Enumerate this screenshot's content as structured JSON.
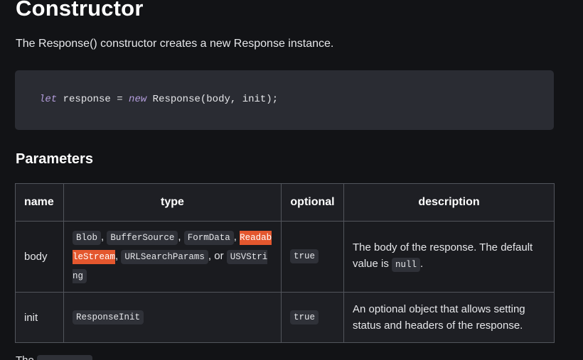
{
  "heading": "Constructor",
  "intro": "The Response() constructor creates a new Response instance.",
  "code": {
    "kw_let": "let",
    "mid": " response = ",
    "kw_new": "new",
    "rest": " Response(body, init);"
  },
  "params_heading": "Parameters",
  "table": {
    "headers": {
      "name": "name",
      "type": "type",
      "optional": "optional",
      "description": "description"
    },
    "rows": [
      {
        "name": "body",
        "types": {
          "t1": "Blob",
          "sep1": ", ",
          "t2": "BufferSource",
          "sep2": ", ",
          "t3": "FormData",
          "sep3": ", ",
          "t4": "ReadableStream",
          "sep4": ", ",
          "t5": "URLSearchParams",
          "sep5": ", or ",
          "t6": "USVString"
        },
        "optional": "true",
        "description_a": "The body of the response. The default value is ",
        "description_code": "null",
        "description_b": "."
      },
      {
        "name": "init",
        "type": "ResponseInit",
        "optional": "true",
        "description": "An optional object that allows setting status and headers of the response."
      }
    ]
  },
  "tail_text": "The",
  "colors": {
    "background": "#121316",
    "code_bg": "#2a2c33",
    "keyword": "#b39ddb",
    "highlight": "#e4572e",
    "border": "#52555c"
  }
}
